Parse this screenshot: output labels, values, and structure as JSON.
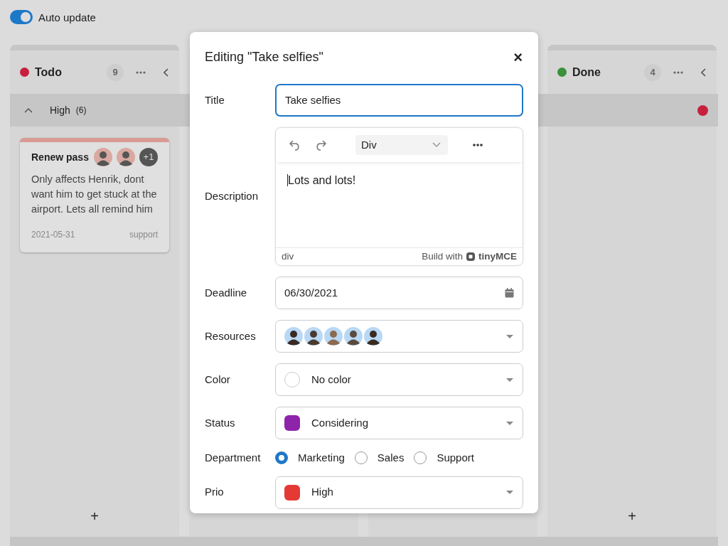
{
  "toggle": {
    "label": "Auto update",
    "on": true
  },
  "columns": [
    {
      "title": "Todo",
      "color": "#c8203c",
      "count": "9",
      "cards": [
        {
          "title": "Renew pass",
          "more": "+1",
          "people": [
            {
              "kind": "person"
            },
            {
              "kind": "person"
            }
          ],
          "description": "Only affects Henrik, dont want him to get stuck at the airport. Lets all remind him",
          "date": "2021-05-31",
          "tag": "support",
          "color": "#d99a94"
        }
      ],
      "add": "+"
    },
    {
      "title": "Done",
      "color": "#3a913a",
      "count": "4",
      "add": "+"
    }
  ],
  "group": {
    "label": "High",
    "count": "(6)",
    "expanded": true,
    "color": "#c8203c"
  },
  "dialog": {
    "title": "Editing \"Take selfies\"",
    "close": "×",
    "fields": [
      {
        "kind": "text",
        "label": "Title",
        "value": "Take selfies",
        "focused": true
      },
      {
        "kind": "editor",
        "label": "Description",
        "format": "Div",
        "content": "Lots and lots!",
        "path": "div",
        "branding": "Build with",
        "brand": "tinyMCE"
      },
      {
        "kind": "date",
        "label": "Deadline",
        "value": "06/30/2021"
      },
      {
        "kind": "avatars",
        "label": "Resources",
        "people": [
          {
            "kind": "person"
          },
          {
            "kind": "person"
          },
          {
            "kind": "person"
          },
          {
            "kind": "person"
          },
          {
            "kind": "person"
          }
        ]
      },
      {
        "kind": "select",
        "label": "Color",
        "value": "No color"
      },
      {
        "kind": "select",
        "label": "Status",
        "value": "Considering",
        "color": "#8e24aa"
      },
      {
        "kind": "radio",
        "label": "Department",
        "options": [
          {
            "label": "Marketing",
            "selected": true
          },
          {
            "label": "Sales",
            "selected": false
          },
          {
            "label": "Support",
            "selected": false
          }
        ]
      },
      {
        "kind": "select",
        "label": "Prio",
        "value": "High",
        "color": "#e53935"
      }
    ]
  }
}
